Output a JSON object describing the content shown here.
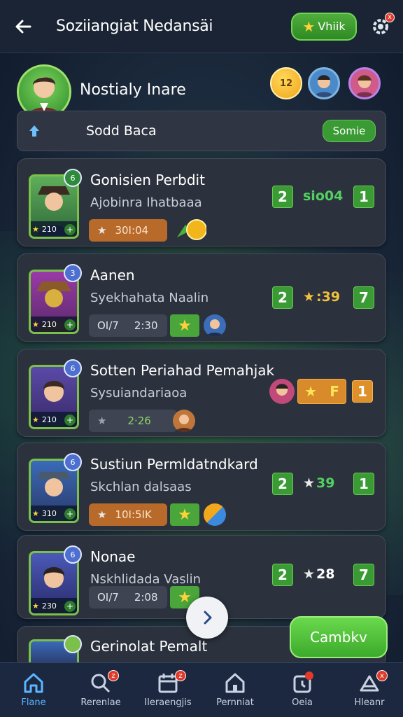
{
  "header": {
    "title": "Soziiangiat Nedansäi",
    "vip_label": "Vhiik",
    "gear_badge": "x"
  },
  "profile": {
    "name": "Nostialy Inare",
    "coin_label": "12"
  },
  "social": {
    "label": "Sodd Baca",
    "button": "Somie"
  },
  "cards": [
    {
      "title": "Gonisien Perbdit",
      "subtitle": "Ajobinra Ihatbaaa",
      "level": "210",
      "rank": "6",
      "pill": "30I:04",
      "pill_style": "orange",
      "left_num": "2",
      "stat": "sio04",
      "right_num": "1"
    },
    {
      "title": "Aanen",
      "subtitle": "Syekhahata Naalin",
      "level": "210",
      "rank": "3",
      "pill_a": "OI/7",
      "pill_b": "2:30",
      "pill_style": "gray",
      "left_num": "2",
      "stat": ":39",
      "right_num": "7"
    },
    {
      "title": "Sotten Periahad Pemahjak",
      "subtitle": "Sysuiandariaoa",
      "level": "210",
      "rank": "6",
      "pill": "2·26",
      "pill_style": "gray",
      "right_num": "1"
    },
    {
      "title": "Sustiun Permldatndkard",
      "subtitle": "Skchlan dalsaas",
      "level": "310",
      "rank": "6",
      "pill": "10I:5IK",
      "pill_style": "orange",
      "left_num": "2",
      "stat": "39",
      "right_num": "1"
    },
    {
      "title": "Nonae",
      "subtitle": "Nskhlidada Vaslin",
      "level": "230",
      "rank": "6",
      "pill_a": "OI/7",
      "pill_b": "2:08",
      "pill_style": "gray",
      "left_num": "2",
      "stat": "28",
      "right_num": "7"
    },
    {
      "title": "Gerinolat Pemalt"
    }
  ],
  "cta": {
    "label": "Cambkv"
  },
  "nav": [
    {
      "label": "Flane",
      "icon": "home-icon"
    },
    {
      "label": "Rerenlae",
      "icon": "search-icon",
      "badge": "z"
    },
    {
      "label": "Ileraengjis",
      "icon": "calendar-icon",
      "badge": "z"
    },
    {
      "label": "Pernniat",
      "icon": "house-icon"
    },
    {
      "label": "Oeia",
      "icon": "alarm-icon"
    },
    {
      "label": "Hleanr",
      "icon": "trophy-icon",
      "badge": "x"
    }
  ],
  "colors": {
    "accent_green": "#3a9a33",
    "active_nav": "#5bb6ff",
    "card_bg": "#2c323d"
  }
}
